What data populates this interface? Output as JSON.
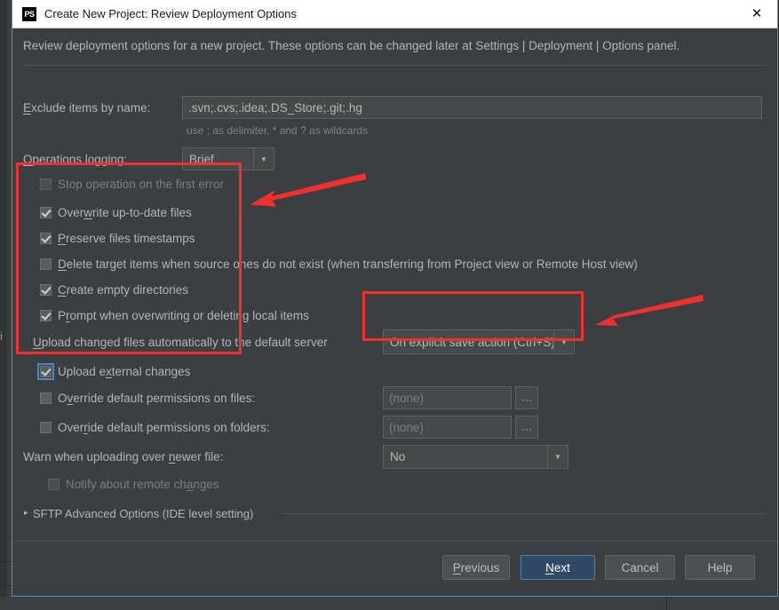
{
  "window": {
    "icon": "phpstorm-ps-icon",
    "icon_text": "PS",
    "title": "Create New Project: Review Deployment Options",
    "close_label": "✕"
  },
  "intro": "Review deployment options for a new project. These options can be changed later at Settings | Deployment | Options panel.",
  "fields": {
    "exclude_label": "Exclude items by name:",
    "exclude_label_mnemonic": "E",
    "exclude_value": ".svn;.cvs;.idea;.DS_Store;.git;.hg",
    "exclude_hint": "use ; as delimiter, * and ? as wildcards",
    "logging_label": "Operations logging:",
    "logging_value": "Brief",
    "upload_auto_label": "Upload changed files automatically to the default server",
    "upload_auto_value": "On explicit save action (Ctrl+S)",
    "override_files_label": "Override default permissions on files:",
    "override_files_value": "(none)",
    "override_folders_label": "Override default permissions on folders:",
    "override_folders_value": "(none)",
    "browse_label": "···",
    "warn_newer_label": "Warn when uploading over newer file:",
    "warn_newer_value": "No",
    "arrow_glyph": "▼"
  },
  "checkboxes": [
    {
      "name": "stop-operation-on-first-error",
      "label": "Stop operation on the first error",
      "checked": false,
      "dimmed": true,
      "focused": false
    },
    {
      "name": "overwrite-up-to-date-files",
      "label": "Overwrite up-to-date files",
      "checked": true,
      "dimmed": false,
      "focused": false
    },
    {
      "name": "preserve-files-timestamps",
      "label": "Preserve files timestamps",
      "checked": true,
      "dimmed": false,
      "focused": false
    },
    {
      "name": "delete-target-items",
      "label": "Delete target items when source ones do not exist (when transferring from Project view or Remote Host view)",
      "checked": false,
      "dimmed": false,
      "focused": false
    },
    {
      "name": "create-empty-directories",
      "label": "Create empty directories",
      "checked": true,
      "dimmed": false,
      "focused": false
    },
    {
      "name": "prompt-when-overwriting",
      "label": "Prompt when overwriting or deleting local items",
      "checked": true,
      "dimmed": false,
      "focused": false
    },
    {
      "name": "upload-external-changes",
      "label": "Upload external changes",
      "checked": true,
      "dimmed": false,
      "focused": true
    },
    {
      "name": "override-permissions-files",
      "label": "Override default permissions on files:",
      "checked": false,
      "dimmed": false,
      "focused": false
    },
    {
      "name": "override-permissions-folders",
      "label": "Override default permissions on folders:",
      "checked": false,
      "dimmed": false,
      "focused": false
    },
    {
      "name": "notify-about-remote-changes",
      "label": "Notify about remote changes",
      "checked": false,
      "dimmed": true,
      "focused": false
    }
  ],
  "advanced": {
    "arrow": "▸",
    "label": "SFTP Advanced Options (IDE level setting)"
  },
  "footer": {
    "previous": "Previous",
    "next": "Next",
    "cancel": "Cancel",
    "help": "Help"
  },
  "backdrop": {
    "glyph": "i"
  },
  "colors": {
    "accent_blue": "#3a93e8",
    "annotation_red": "#f23030",
    "primary_button": "#2f4964",
    "dialog_bg": "#3c3f41",
    "field_bg": "#45494a"
  }
}
